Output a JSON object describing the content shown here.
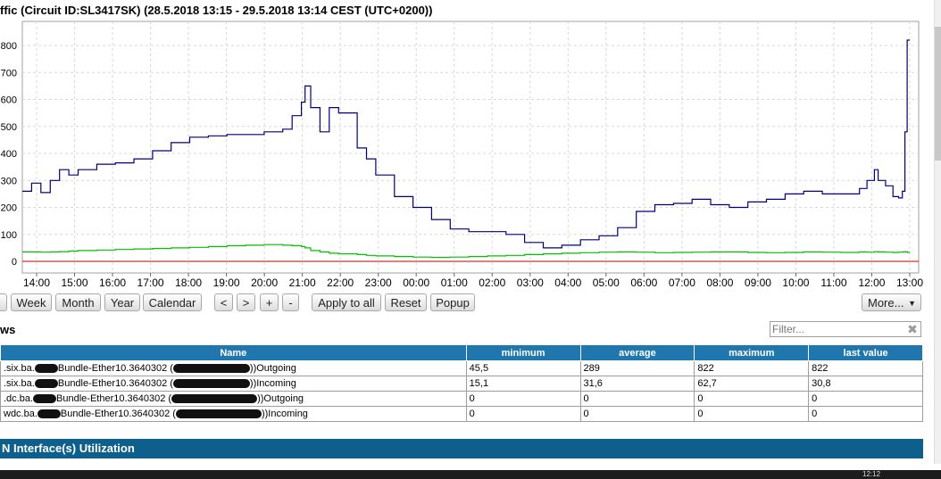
{
  "page": {
    "title": "ffic (Circuit ID:SL3417SK) (28.5.2018 13:15 - 29.5.2018 13:14 CEST (UTC+0200))"
  },
  "colors": {
    "outgoing": "#00007f",
    "incoming": "#00c000",
    "zero_line": "#c00000",
    "header_blue": "#2077ad",
    "footer_blue": "#0e5f8c"
  },
  "chart_data": {
    "type": "line",
    "grid": true,
    "ylim": [
      0,
      850
    ],
    "yticks": [
      "0",
      "100",
      "200",
      "300",
      "400",
      "500",
      "600",
      "700",
      "800"
    ],
    "ytick_labels": [
      "0",
      "100",
      "200",
      "300",
      "400",
      "500",
      "600",
      "700",
      "800"
    ],
    "xticks": [
      "14:00",
      "15:00",
      "16:00",
      "17:00",
      "18:00",
      "19:00",
      "20:00",
      "21:00",
      "22:00",
      "23:00",
      "00:00",
      "01:00",
      "02:00",
      "03:00",
      "04:00",
      "05:00",
      "06:00",
      "07:00",
      "08:00",
      "09:00",
      "10:00",
      "11:00",
      "12:00",
      "13:00"
    ],
    "x_hours_from_13": [
      0,
      0.25,
      0.5,
      0.75,
      1,
      1.25,
      1.5,
      2,
      2.5,
      3,
      3.5,
      4,
      4.5,
      5,
      5.5,
      6,
      6.5,
      7,
      7.25,
      7.5,
      7.6,
      7.75,
      8,
      8.25,
      8.5,
      9,
      9.25,
      9.5,
      10,
      10.5,
      11,
      11.5,
      12,
      12.5,
      13,
      13.5,
      14,
      14.5,
      15,
      15.5,
      16,
      16.5,
      17,
      17.5,
      18,
      18.5,
      19,
      19.5,
      20,
      20.5,
      21,
      21.5,
      22,
      22.5,
      22.7,
      22.9,
      23,
      23.2,
      23.4,
      23.55,
      23.65,
      23.72,
      23.78,
      23.85
    ],
    "series": [
      {
        "values": [
          260,
          290,
          255,
          300,
          340,
          320,
          340,
          360,
          365,
          380,
          410,
          440,
          460,
          465,
          470,
          470,
          480,
          490,
          540,
          590,
          650,
          570,
          480,
          570,
          550,
          420,
          380,
          320,
          240,
          200,
          155,
          120,
          110,
          110,
          100,
          70,
          50,
          60,
          80,
          95,
          125,
          185,
          210,
          215,
          230,
          210,
          200,
          220,
          230,
          250,
          260,
          250,
          250,
          270,
          300,
          340,
          300,
          280,
          240,
          235,
          260,
          480,
          820,
          820
        ]
      },
      {
        "values": [
          35,
          35,
          34,
          35,
          36,
          38,
          40,
          42,
          44,
          46,
          48,
          50,
          52,
          55,
          58,
          60,
          62,
          60,
          58,
          55,
          50,
          40,
          35,
          30,
          28,
          25,
          22,
          20,
          18,
          16,
          15,
          16,
          18,
          20,
          22,
          25,
          28,
          30,
          32,
          34,
          35,
          34,
          32,
          33,
          34,
          35,
          35,
          33,
          32,
          33,
          35,
          34,
          33,
          35,
          34,
          36,
          35,
          34,
          33,
          34,
          35,
          36,
          33,
          33
        ]
      }
    ]
  },
  "toolbar": {
    "week": "Week",
    "month": "Month",
    "year": "Year",
    "calendar": "Calendar",
    "prev": "<",
    "next": ">",
    "zoom_in": "+",
    "zoom_out": "-",
    "apply_all": "Apply to all",
    "reset": "Reset",
    "popup": "Popup",
    "more": "More..."
  },
  "section": {
    "label": "ws",
    "filter_placeholder": "Filter...",
    "clear_glyph": "✖"
  },
  "table": {
    "headers": [
      "Name",
      "minimum",
      "average",
      "maximum",
      "last value"
    ],
    "rows": [
      {
        "name_a": ".six.ba.",
        "name_b": "Bundle-Ether10.3640302 (",
        "name_c": "))Outgoing",
        "minimum": "45,5",
        "average": "289",
        "maximum": "822",
        "last": "822"
      },
      {
        "name_a": ".six.ba.",
        "name_b": "Bundle-Ether10.3640302 (",
        "name_c": "))Incoming",
        "minimum": "15,1",
        "average": "31,6",
        "maximum": "62,7",
        "last": "30,8"
      },
      {
        "name_a": ".dc.ba.",
        "name_b": "Bundle-Ether10.3640302 (",
        "name_c": "))Outgoing",
        "minimum": "0",
        "average": "0",
        "maximum": "0",
        "last": "0"
      },
      {
        "name_a": "wdc.ba.",
        "name_b": "Bundle-Ether10.3640302 (",
        "name_c": "))Incoming",
        "minimum": "0",
        "average": "0",
        "maximum": "0",
        "last": "0"
      }
    ]
  },
  "footer": {
    "label": "N Interface(s) Utilization"
  },
  "taskbar": {
    "clock": "12:12"
  }
}
